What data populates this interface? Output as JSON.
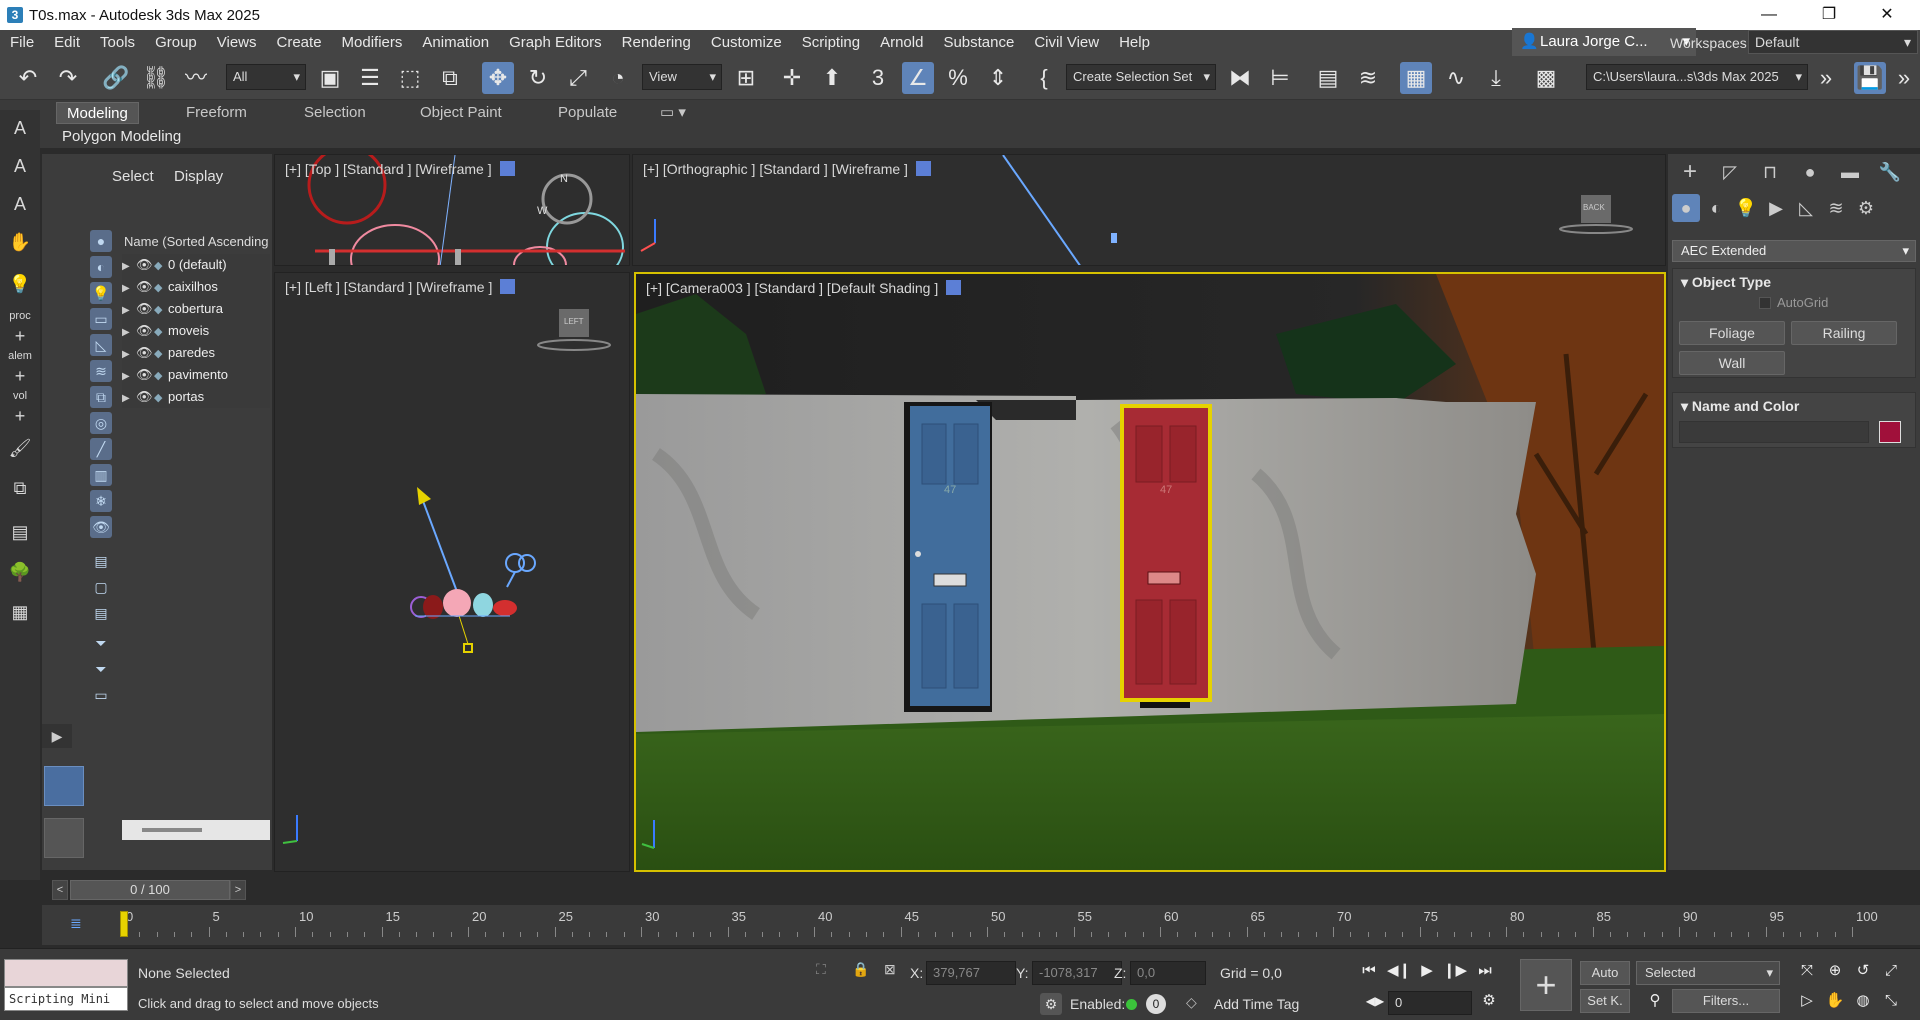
{
  "window": {
    "title": "T0s.max - Autodesk 3ds Max 2025"
  },
  "menus": [
    "File",
    "Edit",
    "Tools",
    "Group",
    "Views",
    "Create",
    "Modifiers",
    "Animation",
    "Graph Editors",
    "Rendering",
    "Customize",
    "Scripting",
    "Arnold",
    "Substance",
    "Civil View",
    "Help"
  ],
  "user": {
    "name": "Laura Jorge C..."
  },
  "workspaces": {
    "label": "Workspaces:",
    "value": "Default"
  },
  "toolbar": {
    "filter": "All",
    "coord_system": "View",
    "selection_set": "Create Selection Set",
    "project_path": "C:\\Users\\laura...s\\3ds Max 2025"
  },
  "ribbon": {
    "tabs": [
      "Modeling",
      "Freeform",
      "Selection",
      "Object Paint",
      "Populate"
    ],
    "active_tab": "Modeling",
    "panel": "Polygon Modeling"
  },
  "scene_explorer": {
    "tabs": [
      "Select",
      "Display"
    ],
    "column_header": "Name (Sorted Ascending",
    "layers": [
      "0 (default)",
      "caixilhos",
      "cobertura",
      "moveis",
      "paredes",
      "pavimento",
      "portas"
    ]
  },
  "viewports": {
    "top": "[+] [Top ] [Standard ] [Wireframe ]",
    "ortho": "[+] [Orthographic ] [Standard ] [Wireframe ]",
    "left": "[+] [Left ] [Standard ] [Wireframe ]",
    "camera": "[+] [Camera003 ] [Standard ] [Default Shading ]",
    "viewcube_left": "LEFT",
    "viewcube_back": "BACK",
    "compass_n": "N",
    "compass_w": "W",
    "door_number": "47"
  },
  "command_panel": {
    "dropdown": "AEC Extended",
    "object_type": {
      "title": "Object Type",
      "autogrid": "AutoGrid",
      "buttons": [
        "Foliage",
        "Railing",
        "Wall"
      ]
    },
    "name_color": {
      "title": "Name and Color",
      "color": "#a0103a"
    }
  },
  "timeline": {
    "frame_counter": "0 / 100",
    "ticks": [
      0,
      5,
      10,
      15,
      20,
      25,
      30,
      35,
      40,
      45,
      50,
      55,
      60,
      65,
      70,
      75,
      80,
      85,
      90,
      95,
      100
    ],
    "current": 0
  },
  "status": {
    "selection": "None Selected",
    "prompt": "Click and drag to select and move objects",
    "script_label": "Scripting Mini",
    "x_label": "X:",
    "x": "379,767",
    "y_label": "Y:",
    "y": "-1078,317",
    "z_label": "Z:",
    "z": "0,0",
    "grid": "Grid = 0,0",
    "enabled_label": "Enabled:",
    "enabled_value": "0",
    "time_tag": "Add Time Tag",
    "auto": "Auto",
    "set_key": "Set K.",
    "selected": "Selected",
    "frame": "0",
    "filters": "Filters..."
  },
  "colors": {
    "accent": "#5f84b9",
    "viewport_border_active": "#d6c100",
    "red_door": "#a72b34",
    "blue_door": "#3f6a9a"
  }
}
